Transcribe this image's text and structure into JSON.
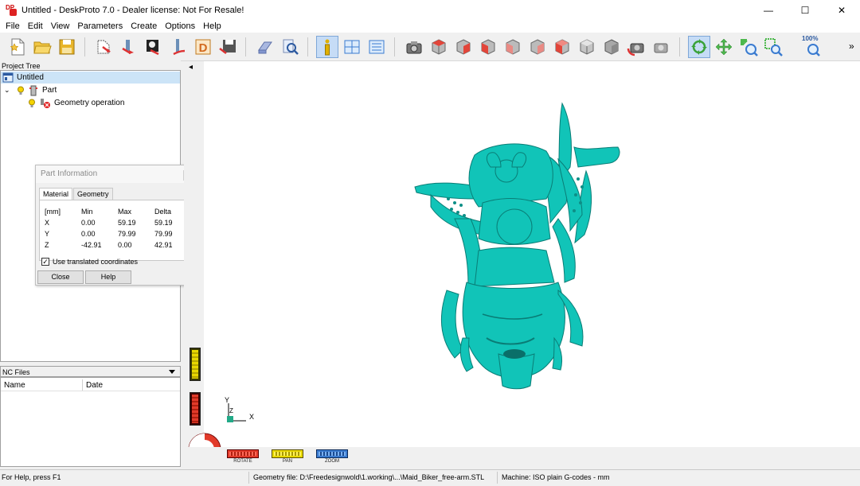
{
  "window": {
    "title": "Untitled - DeskProto 7.0 - Dealer license: Not For Resale!",
    "app_icon_text": "DP",
    "minimize": "—",
    "maximize": "☐",
    "close": "✕"
  },
  "menu": [
    "File",
    "Edit",
    "View",
    "Parameters",
    "Create",
    "Options",
    "Help"
  ],
  "toolbar": {
    "zoom_percent": "100%",
    "overflow": "»"
  },
  "project_tree": {
    "header": "Project Tree",
    "root": "Untitled",
    "expand_glyph": "⌄",
    "part": "Part",
    "operation": "Geometry operation"
  },
  "part_info": {
    "title": "Part Information",
    "tabs": [
      "Material",
      "Geometry"
    ],
    "columns": [
      "[mm]",
      "Min",
      "Max",
      "Delta"
    ],
    "rows": [
      {
        "axis": "X",
        "min": "0.00",
        "max": "59.19",
        "delta": "59.19"
      },
      {
        "axis": "Y",
        "min": "0.00",
        "max": "79.99",
        "delta": "79.99"
      },
      {
        "axis": "Z",
        "min": "-42.91",
        "max": "0.00",
        "delta": "42.91"
      }
    ],
    "use_translated_label": "Use translated coordinates",
    "use_translated_checked": true,
    "check_glyph": "✓",
    "close_label": "Close",
    "help_label": "Help"
  },
  "nc_files": {
    "header": "NC Files",
    "columns": [
      "Name",
      "Date"
    ]
  },
  "viewport": {
    "collapse_glyph": "◂",
    "axis_y": "Y",
    "axis_z": "Z",
    "axis_x": "X",
    "buttons": {
      "rotate": "ROTATE",
      "pan": "PAN",
      "zoom": "ZOOM"
    }
  },
  "statusbar": {
    "help": "For Help, press F1",
    "geometry_file": "Geometry file: D:\\Freedesignwold\\1.working\\...\\Maid_Biker_free-arm.STL",
    "machine": "Machine: ISO plain G-codes - mm"
  },
  "colors": {
    "model": "#11c4b8",
    "accent": "#c6dcf6",
    "red_cube": "#e2453a",
    "grey_cube": "#a8a8a8"
  }
}
